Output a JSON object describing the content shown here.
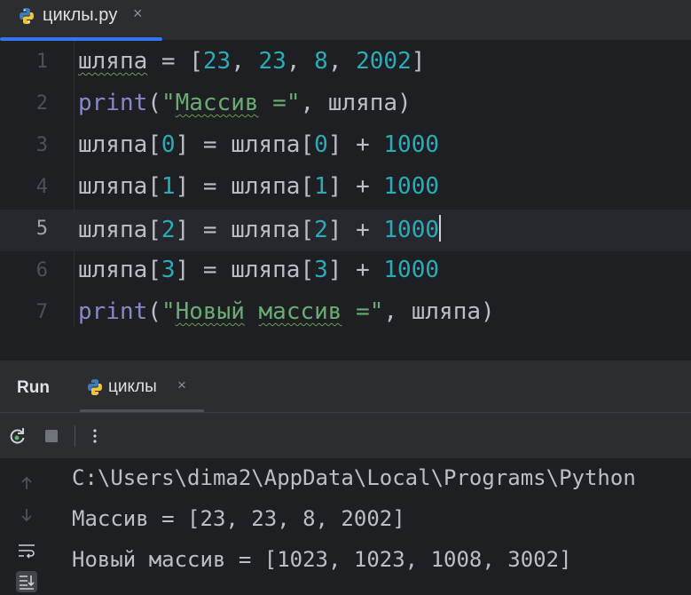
{
  "editor_tab": {
    "title": "циклы.py",
    "close": "×",
    "icon": "python-icon"
  },
  "code_lines": [
    {
      "num": "1",
      "tokens": [
        {
          "t": "шляпа",
          "c": "t-op wavy"
        },
        {
          "t": " = [",
          "c": "t-op"
        },
        {
          "t": "23",
          "c": "t-num"
        },
        {
          "t": ", ",
          "c": "t-op"
        },
        {
          "t": "23",
          "c": "t-num"
        },
        {
          "t": ", ",
          "c": "t-op"
        },
        {
          "t": "8",
          "c": "t-num"
        },
        {
          "t": ", ",
          "c": "t-op"
        },
        {
          "t": "2002",
          "c": "t-num"
        },
        {
          "t": "]",
          "c": "t-op"
        }
      ]
    },
    {
      "num": "2",
      "tokens": [
        {
          "t": "print",
          "c": "t-fn"
        },
        {
          "t": "(",
          "c": "t-op"
        },
        {
          "t": "\"",
          "c": "t-str"
        },
        {
          "t": "Массив",
          "c": "t-str wavy"
        },
        {
          "t": " =\"",
          "c": "t-str"
        },
        {
          "t": ", шляпа)",
          "c": "t-op"
        }
      ]
    },
    {
      "num": "3",
      "tokens": [
        {
          "t": "шляпа[",
          "c": "t-op"
        },
        {
          "t": "0",
          "c": "t-num"
        },
        {
          "t": "] = шляпа[",
          "c": "t-op"
        },
        {
          "t": "0",
          "c": "t-num"
        },
        {
          "t": "] + ",
          "c": "t-op"
        },
        {
          "t": "1000",
          "c": "t-num"
        }
      ]
    },
    {
      "num": "4",
      "tokens": [
        {
          "t": "шляпа[",
          "c": "t-op"
        },
        {
          "t": "1",
          "c": "t-num"
        },
        {
          "t": "] = шляпа[",
          "c": "t-op"
        },
        {
          "t": "1",
          "c": "t-num"
        },
        {
          "t": "] + ",
          "c": "t-op"
        },
        {
          "t": "1000",
          "c": "t-num"
        }
      ]
    },
    {
      "num": "5",
      "current": true,
      "tokens": [
        {
          "t": "шляпа[",
          "c": "t-op"
        },
        {
          "t": "2",
          "c": "t-num"
        },
        {
          "t": "] = шляпа[",
          "c": "t-op"
        },
        {
          "t": "2",
          "c": "t-num"
        },
        {
          "t": "] + ",
          "c": "t-op"
        },
        {
          "t": "1000",
          "c": "t-num"
        }
      ]
    },
    {
      "num": "6",
      "tokens": [
        {
          "t": "шляпа[",
          "c": "t-op"
        },
        {
          "t": "3",
          "c": "t-num"
        },
        {
          "t": "] = шляпа[",
          "c": "t-op"
        },
        {
          "t": "3",
          "c": "t-num"
        },
        {
          "t": "] + ",
          "c": "t-op"
        },
        {
          "t": "1000",
          "c": "t-num"
        }
      ]
    },
    {
      "num": "7",
      "tokens": [
        {
          "t": "print",
          "c": "t-fn"
        },
        {
          "t": "(",
          "c": "t-op"
        },
        {
          "t": "\"",
          "c": "t-str"
        },
        {
          "t": "Новый",
          "c": "t-str wavy"
        },
        {
          "t": " ",
          "c": "t-str"
        },
        {
          "t": "массив",
          "c": "t-str wavy"
        },
        {
          "t": " =\"",
          "c": "t-str"
        },
        {
          "t": ", шляпа)",
          "c": "t-op"
        }
      ]
    }
  ],
  "run_window": {
    "label": "Run",
    "tab_title": "циклы",
    "tab_close": "×",
    "toolbar": [
      "rerun-icon",
      "stop-icon",
      "more-icon"
    ],
    "side_icons": [
      "up-arrow-icon",
      "down-arrow-icon",
      "soft-wrap-icon",
      "scroll-to-end-icon"
    ]
  },
  "console_lines": [
    "C:\\Users\\dima2\\AppData\\Local\\Programs\\Python",
    "Массив = [23, 23, 8, 2002]",
    "Новый массив = [1023, 1023, 1008, 3002]"
  ],
  "colors": {
    "background": "#1e1f22",
    "panel": "#2b2d30",
    "accent": "#3574f0",
    "number": "#2aacb8",
    "string": "#6aab73",
    "builtin": "#8888c6"
  }
}
